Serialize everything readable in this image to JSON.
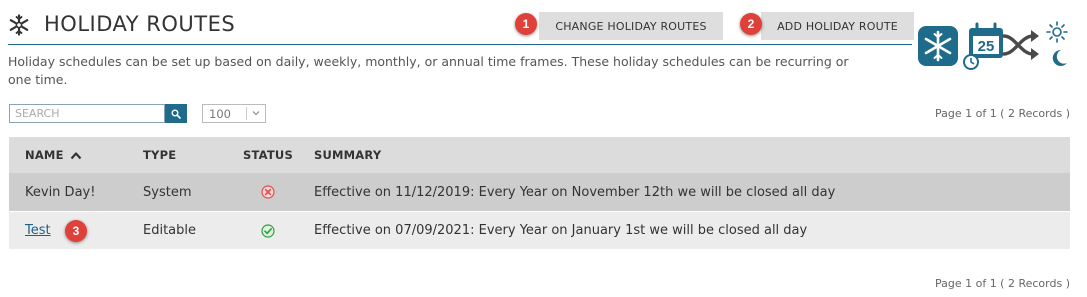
{
  "header": {
    "title": "HOLIDAY ROUTES",
    "icon": "snowflake-icon",
    "description": "Holiday schedules can be set up based on daily, weekly, monthly, or annual time frames. These holiday schedules can be recurring or one time.",
    "art_icons": [
      "snowflake-icon",
      "calendar-icon",
      "crossing-arrows-icon",
      "sun-icon",
      "moon-icon"
    ],
    "calendar_day": "25"
  },
  "toolbar": {
    "change_label": "CHANGE HOLIDAY ROUTES",
    "add_label": "ADD HOLIDAY ROUTE"
  },
  "callouts": [
    "1",
    "2",
    "3"
  ],
  "search": {
    "placeholder": "SEARCH",
    "icon": "search-icon"
  },
  "page_size": {
    "value": "100"
  },
  "pager": {
    "top": "Page 1 of 1 ( 2 Records )",
    "bottom": "Page 1 of 1 ( 2 Records )"
  },
  "table": {
    "columns": {
      "name": "NAME",
      "type": "TYPE",
      "status": "STATUS",
      "summary": "SUMMARY"
    },
    "sort": {
      "column": "name",
      "direction": "ascending"
    },
    "rows": [
      {
        "name": "Kevin Day!",
        "type": "System",
        "status": "inactive",
        "status_icon": "x-circle-icon",
        "summary": "Effective on 11/12/2019: Every Year on November 12th we will be closed all day",
        "link": false
      },
      {
        "name": "Test",
        "type": "Editable",
        "status": "active",
        "status_icon": "check-circle-icon",
        "summary": "Effective on 07/09/2021: Every Year on January 1st we will be closed all day",
        "link": true
      }
    ]
  },
  "colors": {
    "accent": "#1f6b8c",
    "badge": "#e0403a",
    "status_ok": "#2e9e3e",
    "status_bad": "#e04b4b"
  }
}
